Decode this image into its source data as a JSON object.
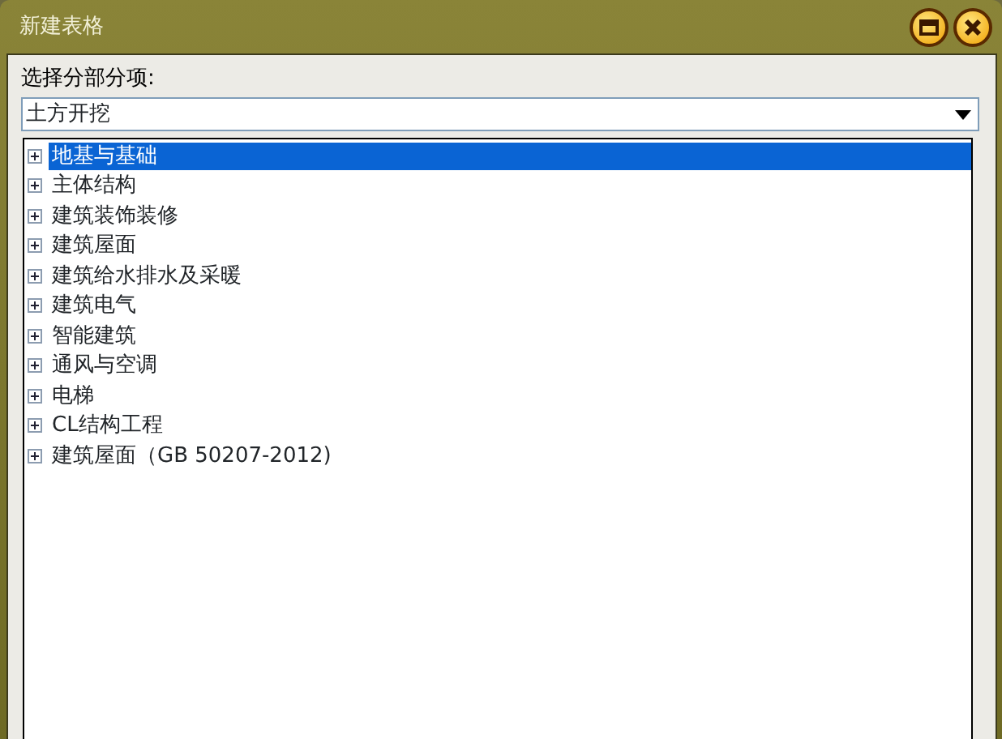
{
  "window": {
    "title": "新建表格"
  },
  "field": {
    "label": "选择分部分项:",
    "value": "土方开挖"
  },
  "tree": [
    {
      "label": "地基与基础",
      "expanded": false,
      "selected": true
    },
    {
      "label": "主体结构",
      "expanded": false,
      "selected": false
    },
    {
      "label": "建筑装饰装修",
      "expanded": false,
      "selected": false
    },
    {
      "label": "建筑屋面",
      "expanded": false,
      "selected": false
    },
    {
      "label": "建筑给水排水及采暖",
      "expanded": false,
      "selected": false
    },
    {
      "label": "建筑电气",
      "expanded": false,
      "selected": false
    },
    {
      "label": "智能建筑",
      "expanded": false,
      "selected": false
    },
    {
      "label": "通风与空调",
      "expanded": false,
      "selected": false
    },
    {
      "label": "电梯",
      "expanded": false,
      "selected": false
    },
    {
      "label": "CL结构工程",
      "expanded": false,
      "selected": false
    },
    {
      "label": "建筑屋面（GB 50207-2012)",
      "expanded": false,
      "selected": false
    }
  ]
}
